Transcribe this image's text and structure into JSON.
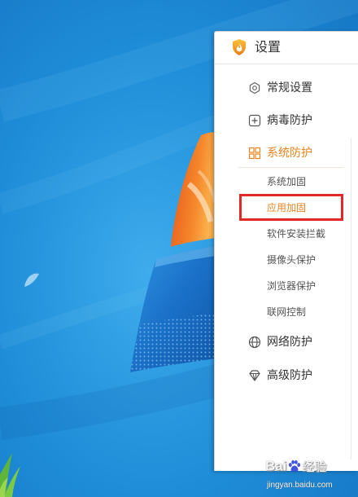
{
  "window": {
    "title": "设置",
    "icon": "shield-flame-icon"
  },
  "sidebar": {
    "items": [
      {
        "label": "常规设置",
        "icon": "gear-icon"
      },
      {
        "label": "病毒防护",
        "icon": "plus-square-icon"
      },
      {
        "label": "系统防护",
        "icon": "grid-icon",
        "active": true
      },
      {
        "label": "网络防护",
        "icon": "globe-icon"
      },
      {
        "label": "高级防护",
        "icon": "diamond-icon"
      }
    ],
    "subitems": [
      {
        "label": "系统加固"
      },
      {
        "label": "应用加固",
        "active": true
      },
      {
        "label": "软件安装拦截"
      },
      {
        "label": "摄像头保护"
      },
      {
        "label": "浏览器保护"
      },
      {
        "label": "联网控制"
      }
    ]
  },
  "annotation": {
    "type": "highlight-box",
    "color": "#e02a2a"
  },
  "watermark": {
    "brand_left": "Bai",
    "brand_icon": "baidu-paw-icon",
    "brand_right": "经验",
    "url": "jingyan.baidu.com"
  },
  "colors": {
    "accent": "#e8841f",
    "text": "#333333",
    "subtext": "#555555",
    "desktop": "#1f8bd7"
  }
}
